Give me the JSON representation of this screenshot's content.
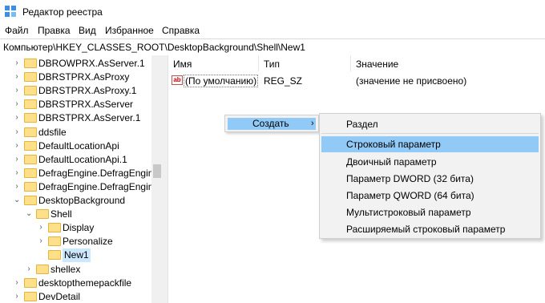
{
  "window": {
    "title": "Редактор реестра",
    "app_icon": "registry-editor-icon"
  },
  "menubar": {
    "items": [
      "Файл",
      "Правка",
      "Вид",
      "Избранное",
      "Справка"
    ]
  },
  "address": {
    "path": "Компьютер\\HKEY_CLASSES_ROOT\\DesktopBackground\\Shell\\New1"
  },
  "tree": {
    "items": [
      {
        "label": "DBROWPRX.AsServer.1",
        "expander": "collapsed"
      },
      {
        "label": "DBRSTPRX.AsProxy",
        "expander": "collapsed"
      },
      {
        "label": "DBRSTPRX.AsProxy.1",
        "expander": "collapsed"
      },
      {
        "label": "DBRSTPRX.AsServer",
        "expander": "collapsed"
      },
      {
        "label": "DBRSTPRX.AsServer.1",
        "expander": "collapsed"
      },
      {
        "label": "ddsfile",
        "expander": "collapsed"
      },
      {
        "label": "DefaultLocationApi",
        "expander": "collapsed"
      },
      {
        "label": "DefaultLocationApi.1",
        "expander": "collapsed"
      },
      {
        "label": "DefragEngine.DefragEngine",
        "expander": "collapsed"
      },
      {
        "label": "DefragEngine.DefragEngine.",
        "expander": "collapsed"
      },
      {
        "label": "DesktopBackground",
        "expander": "expanded"
      },
      {
        "label": "Shell",
        "expander": "expanded"
      },
      {
        "label": "Display",
        "expander": "collapsed"
      },
      {
        "label": "Personalize",
        "expander": "collapsed"
      },
      {
        "label": "New1",
        "expander": "none",
        "selected": true
      },
      {
        "label": "shellex",
        "expander": "collapsed"
      },
      {
        "label": "desktopthemepackfile",
        "expander": "collapsed"
      },
      {
        "label": "DevDetail",
        "expander": "collapsed"
      }
    ]
  },
  "values": {
    "headers": {
      "name": "Имя",
      "type": "Тип",
      "data": "Значение"
    },
    "rows": [
      {
        "name": "(По умолчанию)",
        "type": "REG_SZ",
        "data": "(значение не присвоено)",
        "icon": "string-value-icon",
        "icon_text": "ab"
      }
    ]
  },
  "context_menu": {
    "create_label": "Создать",
    "create_arrow": "›"
  },
  "submenu": {
    "items": [
      "Раздел",
      "Строковый параметр",
      "Двоичный параметр",
      "Параметр DWORD (32 бита)",
      "Параметр QWORD (64 бита)",
      "Мультистроковый параметр",
      "Расширяемый строковый параметр"
    ],
    "highlighted_index": 1
  },
  "colors": {
    "highlight": "#91c9f7",
    "selected_tree_item": "#cce8ff",
    "folder": "#ffe08a"
  }
}
